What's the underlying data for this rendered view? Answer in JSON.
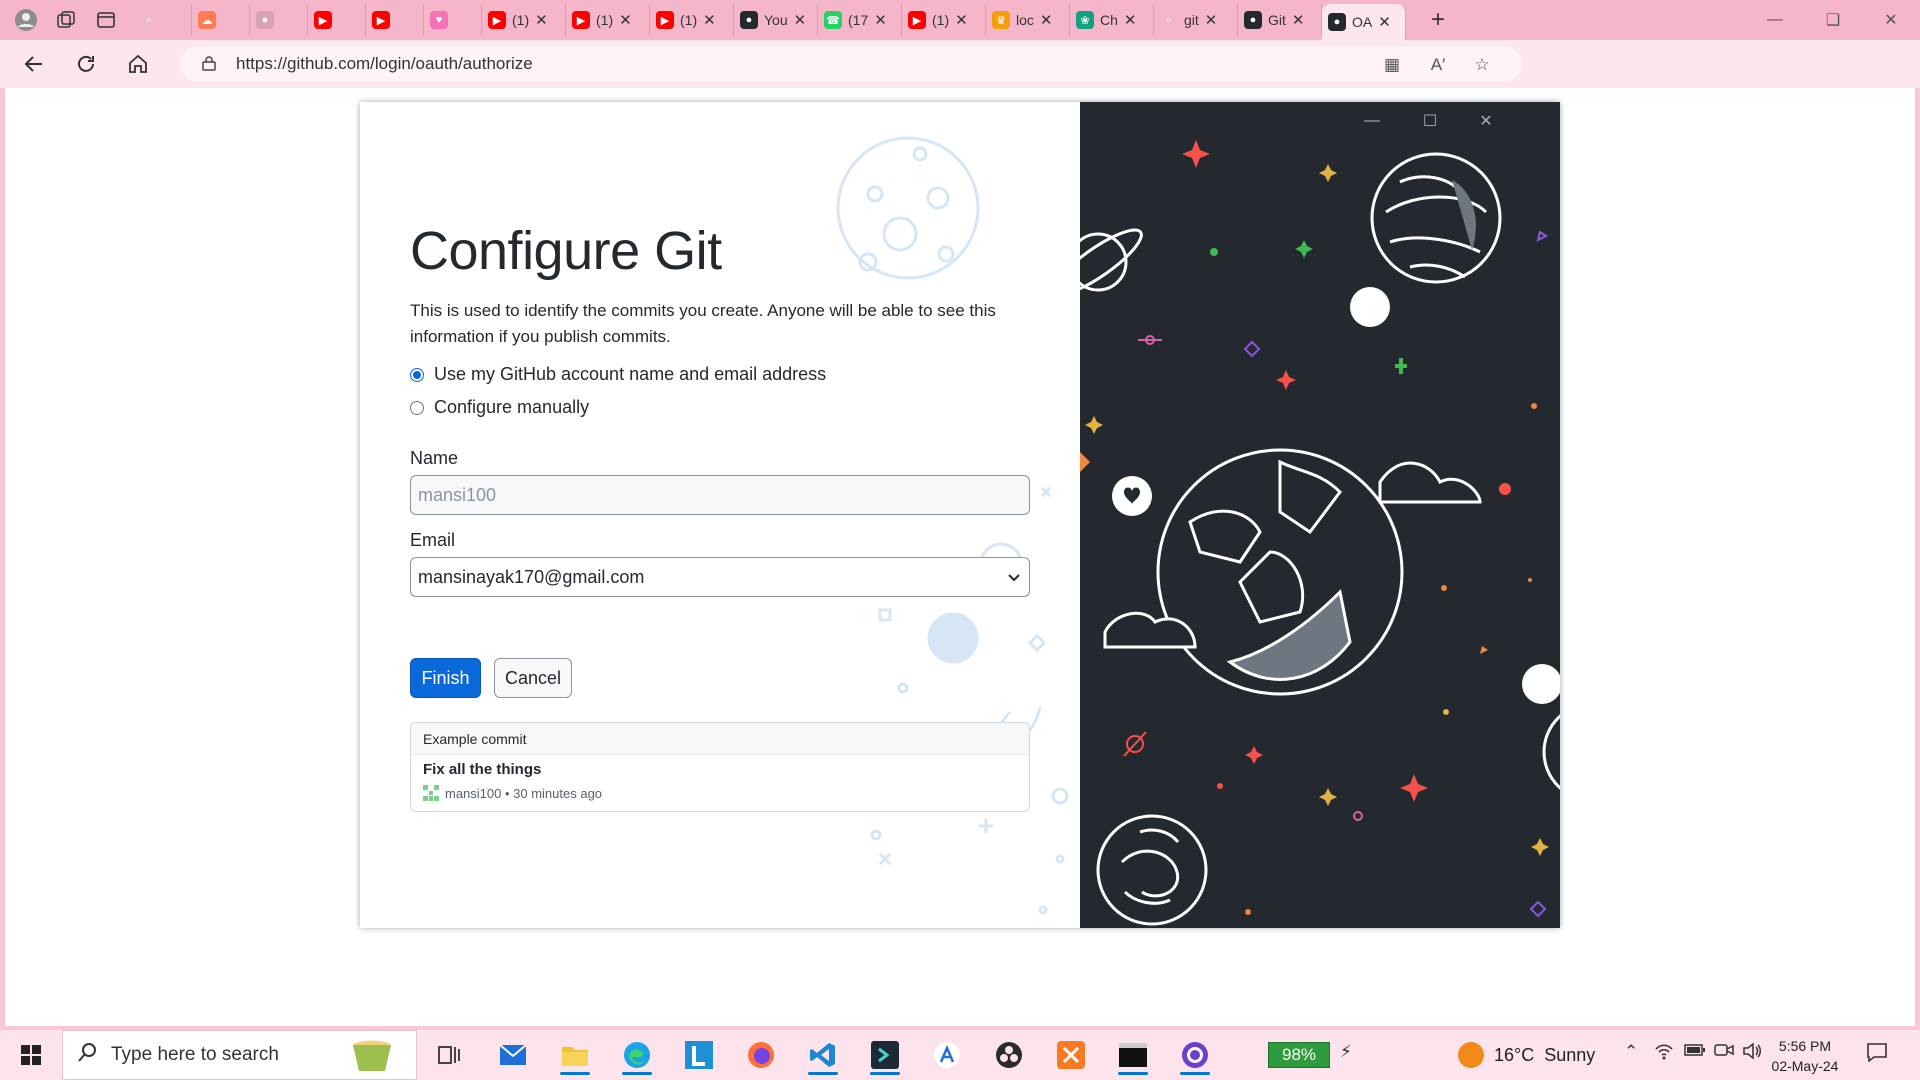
{
  "browser": {
    "tabs": [
      {
        "label": "",
        "fav": "search-icon",
        "color": "#f6b6ca"
      },
      {
        "label": "",
        "fav": "cloud-icon",
        "color": "#ff7b54"
      },
      {
        "label": "",
        "fav": "generic-icon",
        "color": "#d9a1b4"
      },
      {
        "label": "",
        "fav": "youtube-icon",
        "color": "#ff0000"
      },
      {
        "label": "",
        "fav": "youtube-icon",
        "color": "#ff0000"
      },
      {
        "label": "",
        "fav": "heart-icon",
        "color": "#f472b6"
      },
      {
        "label": "(1)",
        "fav": "youtube-icon",
        "color": "#ff0000"
      },
      {
        "label": "(1)",
        "fav": "youtube-icon",
        "color": "#ff0000"
      },
      {
        "label": "(1)",
        "fav": "youtube-icon",
        "color": "#ff0000"
      },
      {
        "label": "You",
        "fav": "github-icon",
        "color": "#24292f"
      },
      {
        "label": "(17",
        "fav": "whatsapp-icon",
        "color": "#25d366"
      },
      {
        "label": "(1)",
        "fav": "youtube-icon",
        "color": "#ff0000"
      },
      {
        "label": "loc",
        "fav": "crown-icon",
        "color": "#f59e0b"
      },
      {
        "label": "Ch",
        "fav": "chatgpt-icon",
        "color": "#10a37f"
      },
      {
        "label": "git",
        "fav": "search-icon",
        "color": "#f6b6ca"
      },
      {
        "label": "Git",
        "fav": "github-icon",
        "color": "#24292f"
      },
      {
        "label": "OA",
        "fav": "github-icon",
        "color": "#24292f"
      }
    ],
    "url": "https://github.com/login/oauth/authorize"
  },
  "dialog": {
    "title": "Configure Git",
    "description": "This is used to identify the commits you create. Anyone will be able to see this information if you publish commits.",
    "options": [
      {
        "label": "Use my GitHub account name and email address",
        "selected": true
      },
      {
        "label": "Configure manually",
        "selected": false
      }
    ],
    "name_label": "Name",
    "name_value": "mansi100",
    "email_label": "Email",
    "email_value": "mansinayak170@gmail.com",
    "finish_label": "Finish",
    "cancel_label": "Cancel",
    "example": {
      "header": "Example commit",
      "message": "Fix all the things",
      "meta": "mansi100 • 30 minutes ago"
    }
  },
  "taskbar": {
    "search_placeholder": "Type here to search",
    "battery": "98%",
    "weather_temp": "16°C",
    "weather_desc": "Sunny",
    "time": "5:56 PM",
    "date": "02-May-24"
  },
  "colors": {
    "accent": "#0969da",
    "illustration_bg": "#24292f",
    "browser_chrome": "#f6b6ca"
  }
}
